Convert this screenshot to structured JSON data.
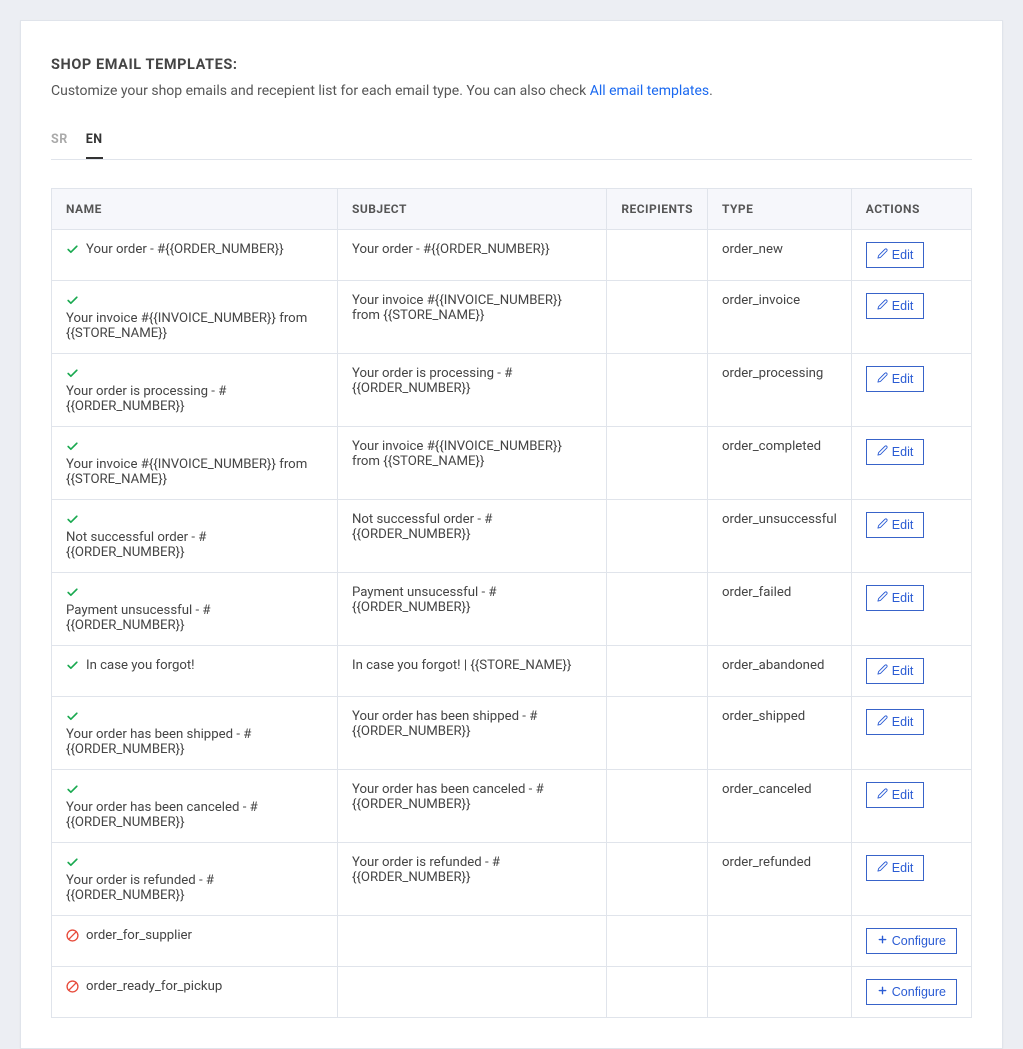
{
  "title": "SHOP EMAIL TEMPLATES:",
  "subtitle_prefix": "Customize your shop emails and recepient list for each email type. You can also check ",
  "subtitle_link": "All email templates",
  "subtitle_suffix": ".",
  "tabs": [
    {
      "label": "SR",
      "active": false
    },
    {
      "label": "EN",
      "active": true
    }
  ],
  "headers": {
    "name": "NAME",
    "subject": "SUBJECT",
    "recipients": "RECIPIENTS",
    "type": "TYPE",
    "actions": "ACTIONS"
  },
  "buttons": {
    "edit": "Edit",
    "configure": "Configure"
  },
  "rows": [
    {
      "status": "ok",
      "name": "Your order - #{{ORDER_NUMBER}}",
      "subject": "Your order - #{{ORDER_NUMBER}}",
      "recipients": "",
      "type": "order_new",
      "action": "edit"
    },
    {
      "status": "ok",
      "name": "Your invoice #{{INVOICE_NUMBER}} from {{STORE_NAME}}",
      "subject": "Your invoice #{{INVOICE_NUMBER}} from {{STORE_NAME}}",
      "recipients": "",
      "type": "order_invoice",
      "action": "edit"
    },
    {
      "status": "ok",
      "name": "Your order is processing - #{{ORDER_NUMBER}}",
      "subject": "Your order is processing - #{{ORDER_NUMBER}}",
      "recipients": "",
      "type": "order_processing",
      "action": "edit"
    },
    {
      "status": "ok",
      "name": "Your invoice #{{INVOICE_NUMBER}} from {{STORE_NAME}}",
      "subject": "Your invoice #{{INVOICE_NUMBER}} from {{STORE_NAME}}",
      "recipients": "",
      "type": "order_completed",
      "action": "edit"
    },
    {
      "status": "ok",
      "name": "Not successful order - #{{ORDER_NUMBER}}",
      "subject": "Not successful order - #{{ORDER_NUMBER}}",
      "recipients": "",
      "type": "order_unsuccessful",
      "action": "edit"
    },
    {
      "status": "ok",
      "name": "Payment unsucessful - #{{ORDER_NUMBER}}",
      "subject": "Payment unsucessful - #{{ORDER_NUMBER}}",
      "recipients": "",
      "type": "order_failed",
      "action": "edit"
    },
    {
      "status": "ok",
      "name": "In case you forgot!",
      "subject": "In case you forgot! | {{STORE_NAME}}",
      "recipients": "",
      "type": "order_abandoned",
      "action": "edit"
    },
    {
      "status": "ok",
      "name": "Your order has been shipped - #{{ORDER_NUMBER}}",
      "subject": "Your order has been shipped - #{{ORDER_NUMBER}}",
      "recipients": "",
      "type": "order_shipped",
      "action": "edit"
    },
    {
      "status": "ok",
      "name": "Your order has been canceled - #{{ORDER_NUMBER}}",
      "subject": "Your order has been canceled - #{{ORDER_NUMBER}}",
      "recipients": "",
      "type": "order_canceled",
      "action": "edit"
    },
    {
      "status": "ok",
      "name": "Your order is refunded - #{{ORDER_NUMBER}}",
      "subject": "Your order is refunded - #{{ORDER_NUMBER}}",
      "recipients": "",
      "type": "order_refunded",
      "action": "edit"
    },
    {
      "status": "blocked",
      "name": "order_for_supplier",
      "subject": "",
      "recipients": "",
      "type": "",
      "action": "configure"
    },
    {
      "status": "blocked",
      "name": "order_ready_for_pickup",
      "subject": "",
      "recipients": "",
      "type": "",
      "action": "configure"
    }
  ]
}
